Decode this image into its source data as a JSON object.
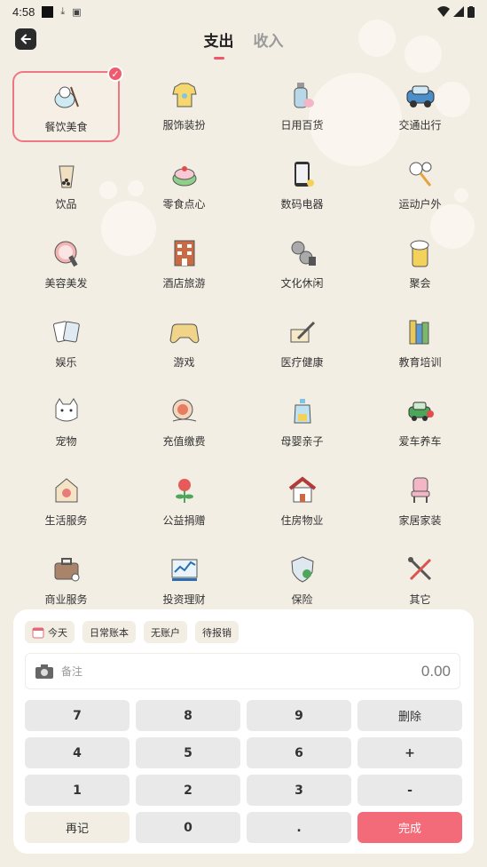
{
  "status_bar": {
    "time": "4:58"
  },
  "header": {
    "tabs": [
      {
        "label": "支出",
        "active": true
      },
      {
        "label": "收入",
        "active": false
      }
    ]
  },
  "categories": [
    {
      "label": "餐饮美食",
      "icon": "rice-bowl-icon",
      "selected": true
    },
    {
      "label": "服饰装扮",
      "icon": "shirt-icon"
    },
    {
      "label": "日用百货",
      "icon": "bottle-icon"
    },
    {
      "label": "交通出行",
      "icon": "car-icon"
    },
    {
      "label": "饮品",
      "icon": "bubble-tea-icon"
    },
    {
      "label": "零食点心",
      "icon": "cake-icon"
    },
    {
      "label": "数码电器",
      "icon": "phone-icon"
    },
    {
      "label": "运动户外",
      "icon": "racket-icon"
    },
    {
      "label": "美容美发",
      "icon": "mirror-icon"
    },
    {
      "label": "酒店旅游",
      "icon": "hotel-icon"
    },
    {
      "label": "文化休闲",
      "icon": "film-reel-icon"
    },
    {
      "label": "聚会",
      "icon": "beer-icon"
    },
    {
      "label": "娱乐",
      "icon": "cards-icon"
    },
    {
      "label": "游戏",
      "icon": "gamepad-icon"
    },
    {
      "label": "医疗健康",
      "icon": "syringe-icon"
    },
    {
      "label": "教育培训",
      "icon": "books-icon"
    },
    {
      "label": "宠物",
      "icon": "cat-icon"
    },
    {
      "label": "充值缴费",
      "icon": "coin-icon"
    },
    {
      "label": "母婴亲子",
      "icon": "baby-bottle-icon"
    },
    {
      "label": "爱车养车",
      "icon": "car-heart-icon"
    },
    {
      "label": "生活服务",
      "icon": "house-basket-icon"
    },
    {
      "label": "公益捐赠",
      "icon": "flower-icon"
    },
    {
      "label": "住房物业",
      "icon": "home-icon"
    },
    {
      "label": "家居家装",
      "icon": "chair-icon"
    },
    {
      "label": "商业服务",
      "icon": "briefcase-icon"
    },
    {
      "label": "投资理财",
      "icon": "chart-icon"
    },
    {
      "label": "保险",
      "icon": "shield-icon"
    },
    {
      "label": "其它",
      "icon": "tools-icon"
    }
  ],
  "panel": {
    "chips": {
      "date": "今天",
      "book": "日常账本",
      "account": "无账户",
      "reimburse": "待报销"
    },
    "note_placeholder": "备注",
    "amount": "0.00",
    "keys": {
      "k7": "7",
      "k8": "8",
      "k9": "9",
      "delete": "删除",
      "k4": "4",
      "k5": "5",
      "k6": "6",
      "plus": "+",
      "k1": "1",
      "k2": "2",
      "k3": "3",
      "minus": "-",
      "again": "再记",
      "k0": "0",
      "dot": ".",
      "done": "完成"
    }
  },
  "colors": {
    "accent": "#f36a79",
    "background": "#f3eee4"
  }
}
